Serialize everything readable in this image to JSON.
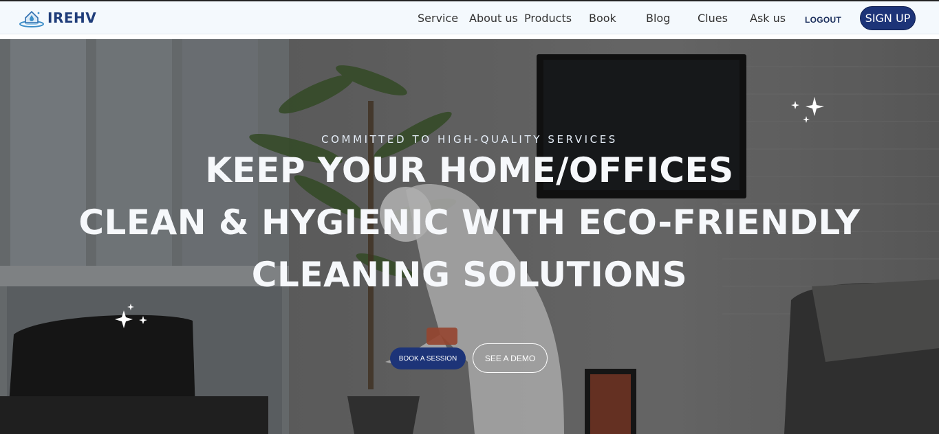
{
  "brand": {
    "name": "IREHV",
    "logo_icon": "house-drop-logo-icon",
    "color": "#1f3d7a"
  },
  "nav": {
    "items": [
      {
        "label": "Service"
      },
      {
        "label": "About us"
      },
      {
        "label": "Products"
      },
      {
        "label": "Book"
      },
      {
        "label": "Blog"
      },
      {
        "label": "Clues"
      },
      {
        "label": "Ask us"
      }
    ],
    "logout_label": "LOGOUT",
    "signup_label": "SIGN UP"
  },
  "hero": {
    "eyebrow": "COMMITTED TO HIGH-QUALITY SERVICES",
    "headline_lines": [
      "KEEP YOUR HOME/OFFICES",
      "CLEAN & HYGIENIC WITH ECO-FRIENDLY",
      "CLEANING SOLUTIONS"
    ],
    "primary_cta": "BOOK A SESSION",
    "secondary_cta": "SEE A DEMO",
    "decorations": [
      "sparkle-icon",
      "sparkle-icon"
    ]
  },
  "colors": {
    "accent": "#1d3478",
    "nav_background": "#f4f9fd"
  }
}
